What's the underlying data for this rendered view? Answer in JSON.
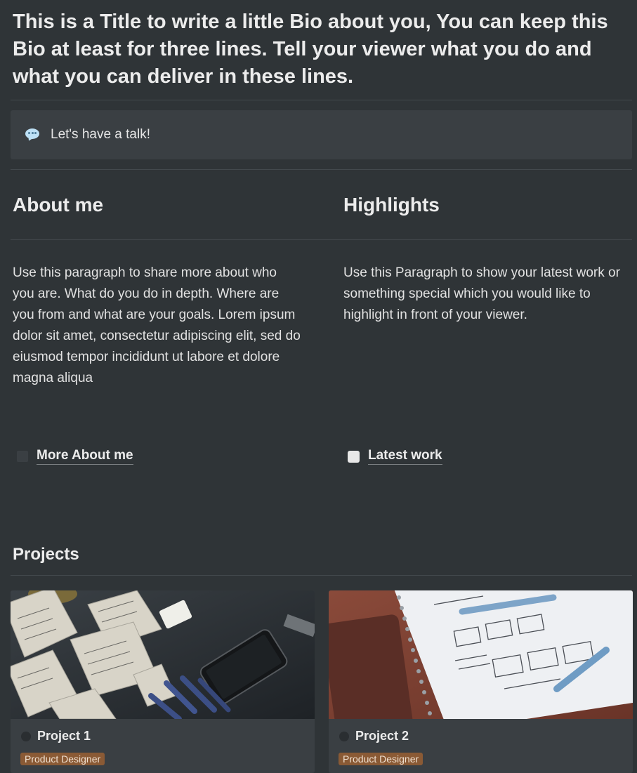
{
  "bio": {
    "title": "This is a Title to write a little Bio about you, You can keep this Bio at least for three lines. Tell your viewer what you do and what you can deliver in these lines."
  },
  "callout": {
    "icon": "speech-bubble-icon",
    "text": "Let's have a talk!"
  },
  "about": {
    "heading": "About me",
    "paragraph": "Use this paragraph to share more about who you are. What do you do in depth. Where are you from and what are your goals. Lorem ipsum dolor sit amet, consectetur adipiscing elit, sed do eiusmod tempor incididunt ut labore et dolore magna aliqua",
    "link_label": "More About me",
    "link_checked": false
  },
  "highlights": {
    "heading": "Highlights",
    "paragraph": "Use this Paragraph to show your latest work or something special which you would like to highlight in front of your viewer.",
    "link_label": "Latest work",
    "link_checked": false
  },
  "projects": {
    "title": "Projects",
    "cards": [
      {
        "name": "Project 1",
        "tag": "Product Designer"
      },
      {
        "name": "Project 2",
        "tag": "Product Designer"
      }
    ]
  },
  "colors": {
    "background": "#2f3437",
    "callout_bg": "#3a3f43",
    "tag_bg": "#8a5a35"
  }
}
